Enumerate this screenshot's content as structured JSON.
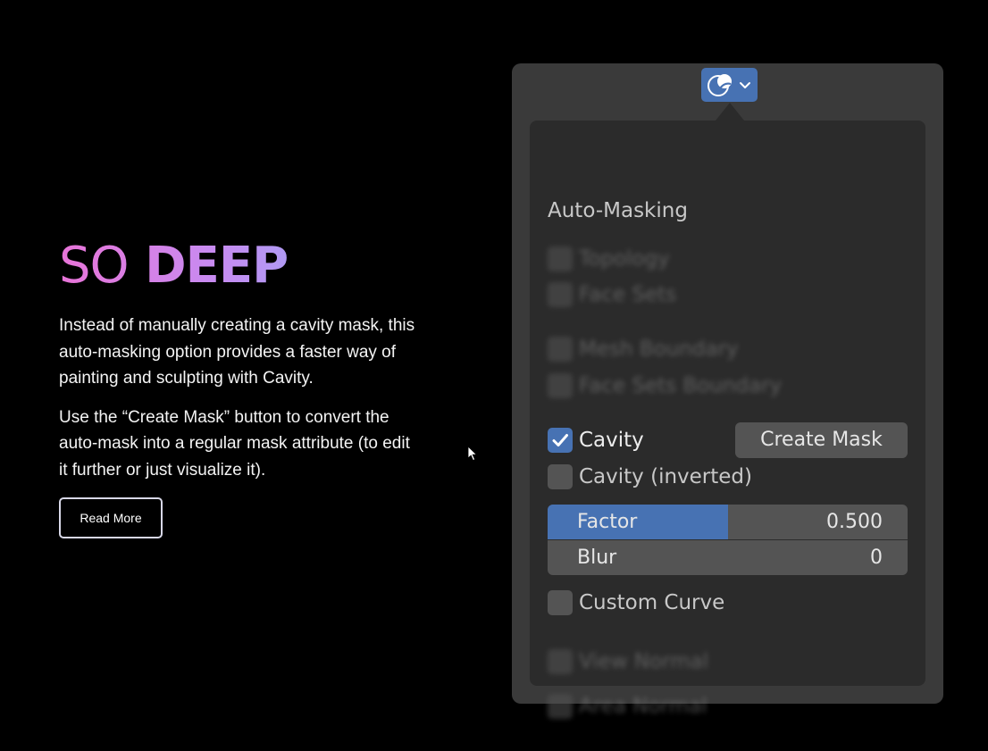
{
  "hero": {
    "headline_light": "SO",
    "headline_bold": "DEEP",
    "paragraph_1": "Instead of manually creating a cavity mask, this auto-masking option provides a faster way of painting and sculpting with Cavity.",
    "paragraph_2": "Use the “Create Mask” button to convert the auto-mask into a regular mask attribute (to edit it further or just visualize it).",
    "read_more_label": "Read More",
    "gradient_colors": [
      "#e874d8",
      "#c68cf2",
      "#86b4f6"
    ]
  },
  "panel": {
    "mode_icon": "automasking-icon",
    "title": "Auto-Masking",
    "options_top": [
      {
        "label": "Topology",
        "checked": false
      },
      {
        "label": "Face Sets",
        "checked": false
      },
      {
        "label": "Mesh Boundary",
        "checked": false
      },
      {
        "label": "Face Sets Boundary",
        "checked": false
      }
    ],
    "cavity": {
      "label": "Cavity",
      "checked": true
    },
    "create_mask_label": "Create Mask",
    "cavity_inverted": {
      "label": "Cavity (inverted)",
      "checked": false
    },
    "factor": {
      "label": "Factor",
      "value": "0.500",
      "fraction": 0.5
    },
    "blur": {
      "label": "Blur",
      "value": "0"
    },
    "custom_curve": {
      "label": "Custom Curve",
      "checked": false
    },
    "options_bottom": [
      {
        "label": "View Normal",
        "checked": false
      },
      {
        "label": "Area Normal",
        "checked": false
      }
    ],
    "accent_color": "#4772b3"
  }
}
